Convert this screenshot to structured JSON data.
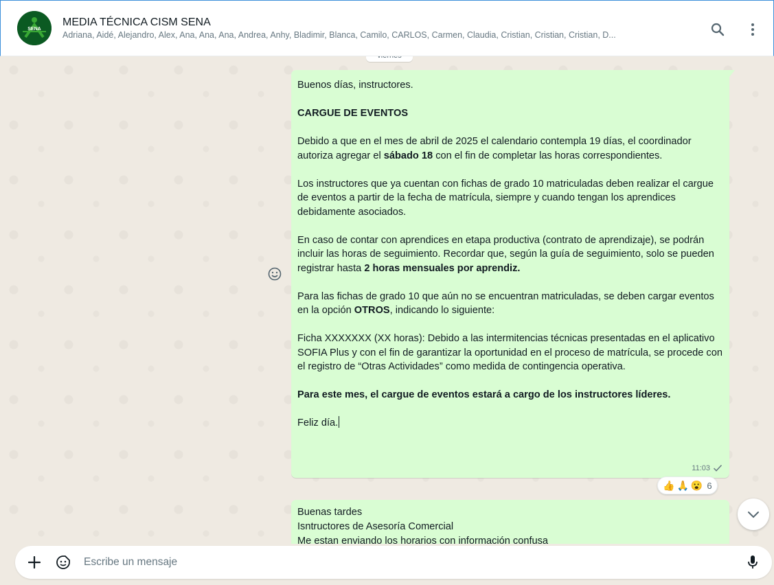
{
  "header": {
    "title": "MEDIA TÉCNICA CISM SENA",
    "members": "Adriana, Aidé, Alejandro, Alex, Ana, Ana, Ana, Andrea, Anhy, Bladimir, Blanca, Camilo, CARLOS, Carmen, Claudia, Cristian, Cristian, Cristian, D...",
    "avatar_text": "SENA",
    "icons": [
      "search-icon",
      "menu-icon"
    ]
  },
  "chat": {
    "date_label": "viernes",
    "message1": {
      "greeting": "Buenos días, instructores.",
      "heading": "CARGUE DE EVENTOS",
      "p1_a": "Debido a que en el mes de abril de 2025 el calendario contempla 19 días, el coordinador autoriza agregar el ",
      "p1_bold": "sábado 18",
      "p1_b": " con el fin de completar las horas correspondientes.",
      "p2": "Los instructores que ya cuentan con fichas de grado 10 matriculadas deben realizar el cargue de eventos a partir de la fecha de matrícula, siempre y cuando tengan los aprendices debidamente asociados.",
      "p3_a": "En caso de contar con aprendices en etapa productiva (contrato de aprendizaje), se podrán incluir las horas de seguimiento. Recordar que, según la guía de seguimiento, solo se pueden registrar hasta ",
      "p3_bold": "2 horas mensuales por aprendiz.",
      "p4_a": "Para las fichas de grado 10 que aún no se encuentran matriculadas, se deben cargar eventos en la opción ",
      "p4_bold": "OTROS",
      "p4_b": ", indicando lo siguiente:",
      "p5": "Ficha XXXXXXX (XX horas): Debido a las intermitencias técnicas presentadas en el aplicativo SOFIA Plus y con el fin de garantizar la oportunidad en el proceso de matrícula, se procede con el registro de “Otras Actividades” como medida de contingencia operativa.",
      "p6_bold": "Para este mes, el cargue de eventos estará a cargo de los instructores líderes.",
      "closing": "Feliz día.",
      "time": "11:03",
      "status": "sent"
    },
    "reactions": {
      "emojis": [
        "👍",
        "🙏",
        "😮"
      ],
      "count": "6"
    },
    "message2": {
      "line1": "Buenas tardes",
      "line2": "Isntructores de Asesoría Comercial",
      "line3": "Me estan enviando los horarios con información confusa"
    }
  },
  "composer": {
    "placeholder": "Escribe un mensaje",
    "icons": [
      "plus-icon",
      "sticker-icon",
      "mic-icon"
    ]
  },
  "colors": {
    "outgoing_bubble": "#d9fdd3",
    "chat_background": "#efeae2",
    "header_background": "#ffffff",
    "secondary_text": "#667781"
  }
}
